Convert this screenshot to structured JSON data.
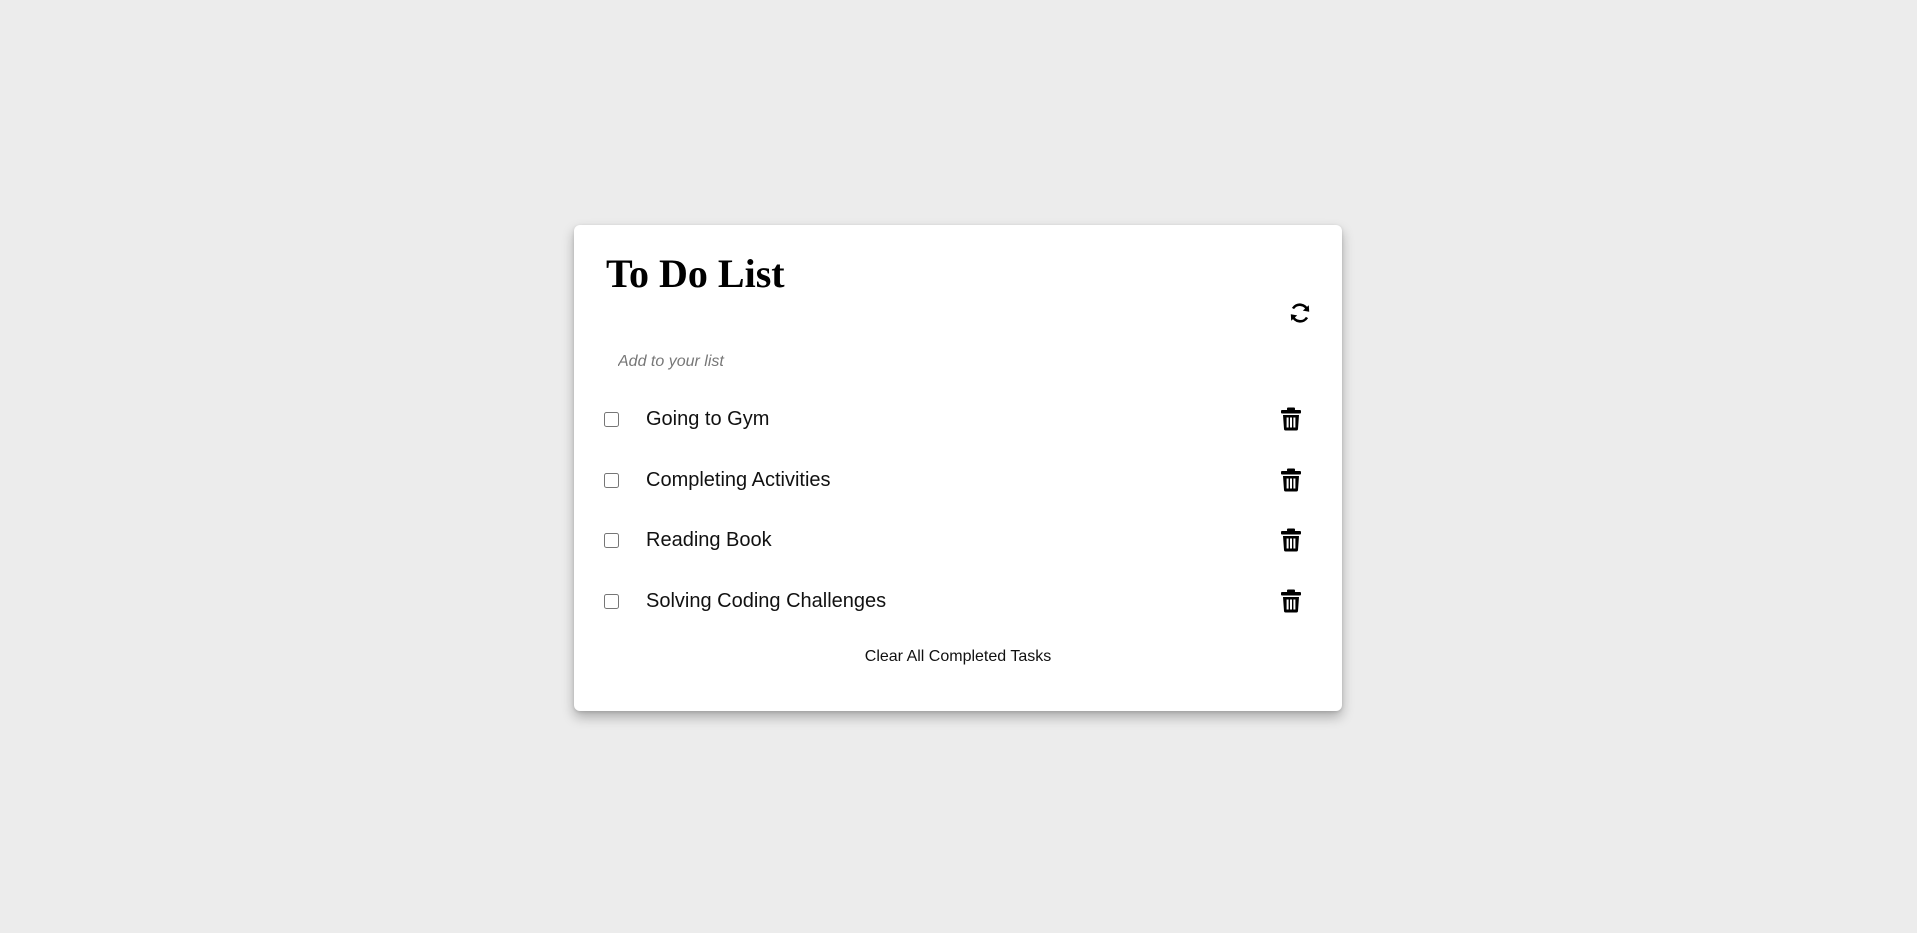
{
  "header": {
    "title": "To Do List",
    "refresh_icon": "refresh-icon"
  },
  "add_input": {
    "value": "",
    "placeholder": "Add to your list"
  },
  "tasks": [
    {
      "label": "Going to Gym",
      "checked": false,
      "delete_icon": "trash-icon"
    },
    {
      "label": "Completing Activities",
      "checked": false,
      "delete_icon": "trash-icon"
    },
    {
      "label": "Reading Book",
      "checked": false,
      "delete_icon": "trash-icon"
    },
    {
      "label": "Solving Coding Challenges",
      "checked": false,
      "delete_icon": "trash-icon"
    }
  ],
  "footer": {
    "clear_label": "Clear All Completed Tasks"
  },
  "colors": {
    "page_background": "#ececec",
    "card_background": "#ffffff",
    "text": "#111111",
    "placeholder": "#777777"
  }
}
